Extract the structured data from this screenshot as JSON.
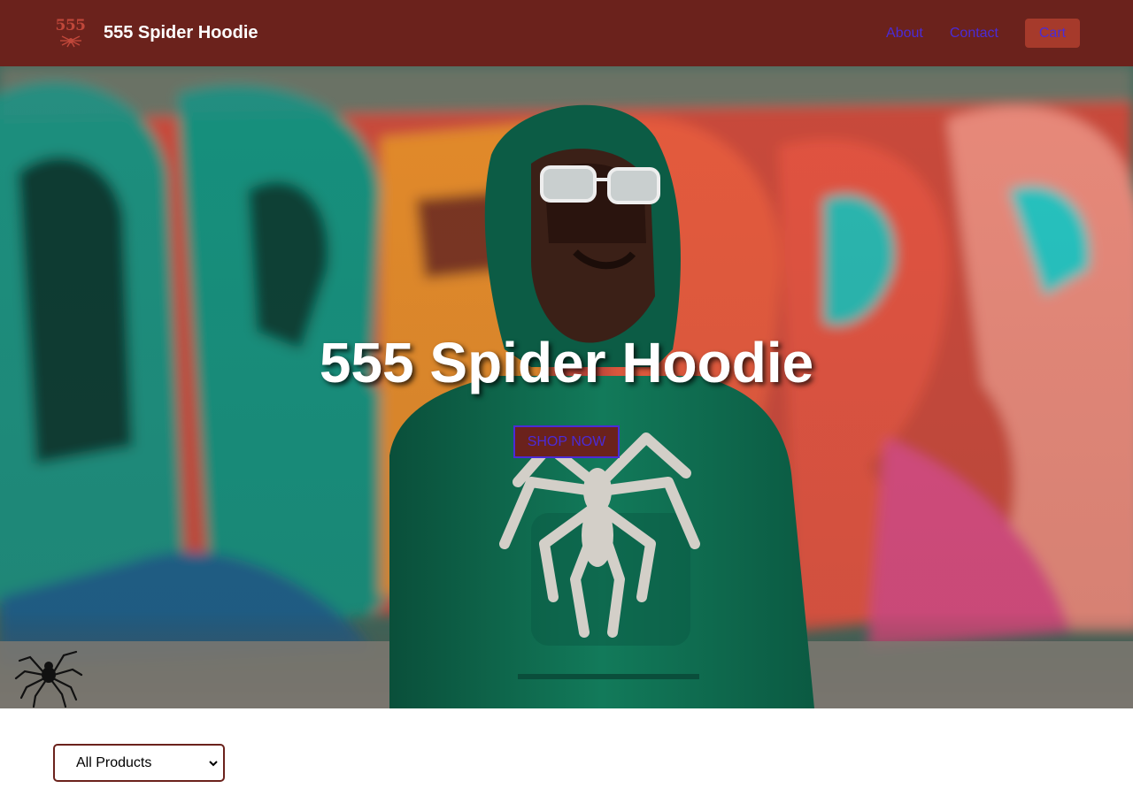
{
  "header": {
    "logo_text": "555",
    "brand_name": "555 Spider Hoodie",
    "nav": [
      {
        "label": "About"
      },
      {
        "label": "Contact"
      },
      {
        "label": "Cart"
      }
    ]
  },
  "hero": {
    "title": "555 Spider Hoodie",
    "cta_label": "SHOP NOW"
  },
  "filter": {
    "selected": "All Products"
  },
  "colors": {
    "header_bg": "#6b221c",
    "cart_bg": "#a63a2b",
    "link": "#4b2bd6",
    "hoodie": "#0f6b4f"
  }
}
